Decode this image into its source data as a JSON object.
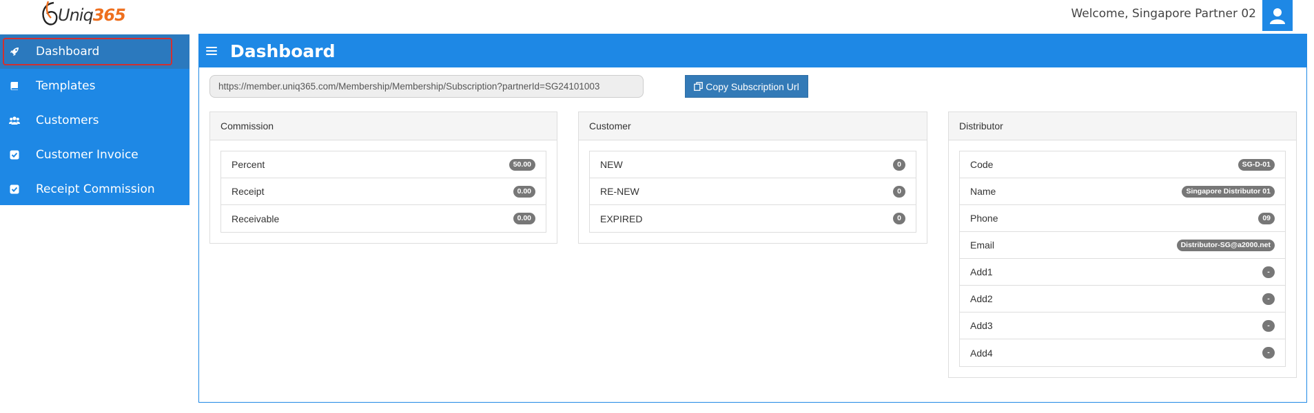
{
  "header": {
    "logo_text_a": "Uniq",
    "logo_text_b": "365",
    "welcome": "Welcome, Singapore Partner 02"
  },
  "sidebar": {
    "items": [
      {
        "label": "Dashboard",
        "icon": "rocket-icon",
        "active": true
      },
      {
        "label": "Templates",
        "icon": "book-icon"
      },
      {
        "label": "Customers",
        "icon": "users-icon"
      },
      {
        "label": "Customer Invoice",
        "icon": "check-square-icon"
      },
      {
        "label": "Receipt Commission",
        "icon": "check-square-icon"
      }
    ]
  },
  "main": {
    "title": "Dashboard",
    "subscription_url": "https://member.uniq365.com/Membership/Membership/Subscription?partnerId=SG24101003",
    "copy_button": "Copy Subscription Url"
  },
  "commission": {
    "title": "Commission",
    "rows": [
      {
        "label": "Percent",
        "value": "50.00"
      },
      {
        "label": "Receipt",
        "value": "0.00"
      },
      {
        "label": "Receivable",
        "value": "0.00"
      }
    ]
  },
  "customer": {
    "title": "Customer",
    "rows": [
      {
        "label": "NEW",
        "value": "0"
      },
      {
        "label": "RE-NEW",
        "value": "0"
      },
      {
        "label": "EXPIRED",
        "value": "0"
      }
    ]
  },
  "distributor": {
    "title": "Distributor",
    "rows": [
      {
        "label": "Code",
        "value": "SG-D-01"
      },
      {
        "label": "Name",
        "value": "Singapore Distributor 01"
      },
      {
        "label": "Phone",
        "value": "09"
      },
      {
        "label": "Email",
        "value": "Distributor-SG@a2000.net"
      },
      {
        "label": "Add1",
        "value": "-"
      },
      {
        "label": "Add2",
        "value": "-"
      },
      {
        "label": "Add3",
        "value": "-"
      },
      {
        "label": "Add4",
        "value": "-"
      }
    ]
  },
  "colors": {
    "primary": "#1e88e5",
    "active_item": "#2b79be",
    "highlight": "#d32f2f",
    "button": "#337ab7",
    "badge": "#777777",
    "logo_accent": "#ee6f1e"
  }
}
